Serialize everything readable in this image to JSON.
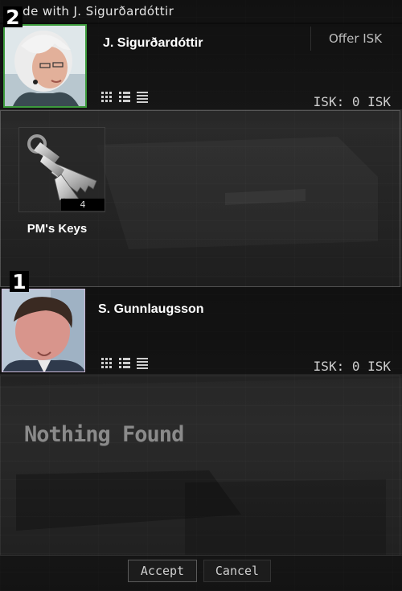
{
  "window": {
    "title_prefix": "rade with",
    "title_name": "J. Sigurðardóttir"
  },
  "parties": [
    {
      "badge": "2",
      "name": "J. Sigurðardóttir",
      "offer_label": "Offer ISK",
      "isk": "ISK: 0 ISK",
      "items": [
        {
          "label": "PM's Keys",
          "quantity": "4",
          "icon": "keys-icon"
        }
      ]
    },
    {
      "badge": "1",
      "name": "S. Gunnlaugsson",
      "isk": "ISK: 0 ISK",
      "empty_text": "Nothing Found"
    }
  ],
  "view_modes": [
    "icon-grid-view-icon",
    "details-list-view-icon",
    "list-view-icon"
  ],
  "footer": {
    "accept_label": "Accept",
    "cancel_label": "Cancel"
  },
  "colors": {
    "portrait1_border": "#3c9a3c",
    "portrait2_border": "#c9b7d4"
  }
}
